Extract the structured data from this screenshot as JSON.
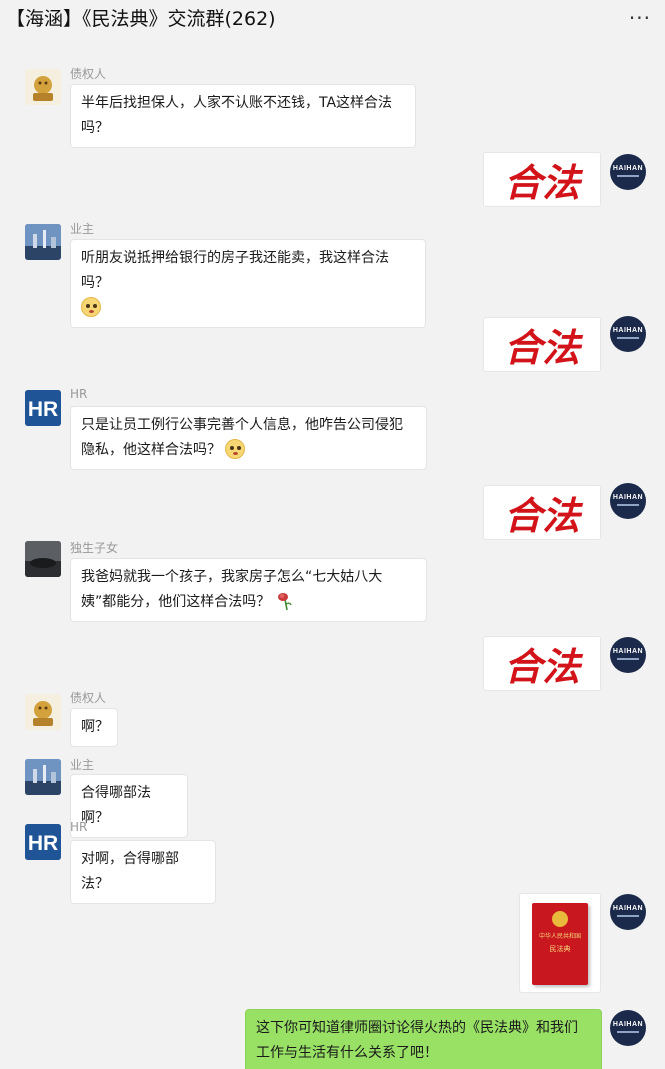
{
  "header": {
    "title": "【海涵】《民法典》交流群(262)",
    "more": "···"
  },
  "messages": [
    {
      "sender": "债权人",
      "text": "半年后找担保人，人家不认账不还钱，TA这样合法吗？"
    },
    {
      "sender": "海涵",
      "avatar_text": "HAIHAN",
      "image_text": "合法"
    },
    {
      "sender": "业主",
      "text": "听朋友说抵押给银行的房子我还能卖，我这样合法吗？"
    },
    {
      "sender": "海涵",
      "avatar_text": "HAIHAN",
      "image_text": "合法"
    },
    {
      "sender": "HR",
      "text": "只是让员工例行公事完善个人信息，他咋告公司侵犯隐私，他这样合法吗？"
    },
    {
      "sender": "海涵",
      "avatar_text": "HAIHAN",
      "image_text": "合法"
    },
    {
      "sender": "独生子女",
      "text": "我爸妈就我一个孩子，我家房子怎么“七大姑八大姨”都能分，他们这样合法吗？"
    },
    {
      "sender": "海涵",
      "avatar_text": "HAIHAN",
      "image_text": "合法"
    },
    {
      "sender": "债权人",
      "text": "啊？"
    },
    {
      "sender": "业主",
      "text": "合得哪部法啊？"
    },
    {
      "sender": "HR",
      "text": "对啊，合得哪部法？"
    },
    {
      "sender": "海涵",
      "avatar_text": "HAIHAN",
      "book_title": "中华人民共和国",
      "book_subtitle": "民法典"
    },
    {
      "sender": "海涵",
      "avatar_text": "HAIHAN",
      "text": "这下你可知道律师圈讨论得火热的《民法典》和我们工作与生活有什么关系了吧！"
    }
  ],
  "names_shown": {
    "creditor": "债权人",
    "owner": "业主",
    "hr": "HR",
    "only_child": "独生子女"
  },
  "icons": {
    "more": "more-dots-icon",
    "confused_emoji": "confused-face-icon",
    "wilted_rose": "wilted-rose-icon"
  },
  "colors": {
    "background": "#f2f2f2",
    "bubble": "#ffffff",
    "bubble_self": "#98e165",
    "legal_red": "#d2141a",
    "haihan_navy": "#1b2a4a"
  }
}
